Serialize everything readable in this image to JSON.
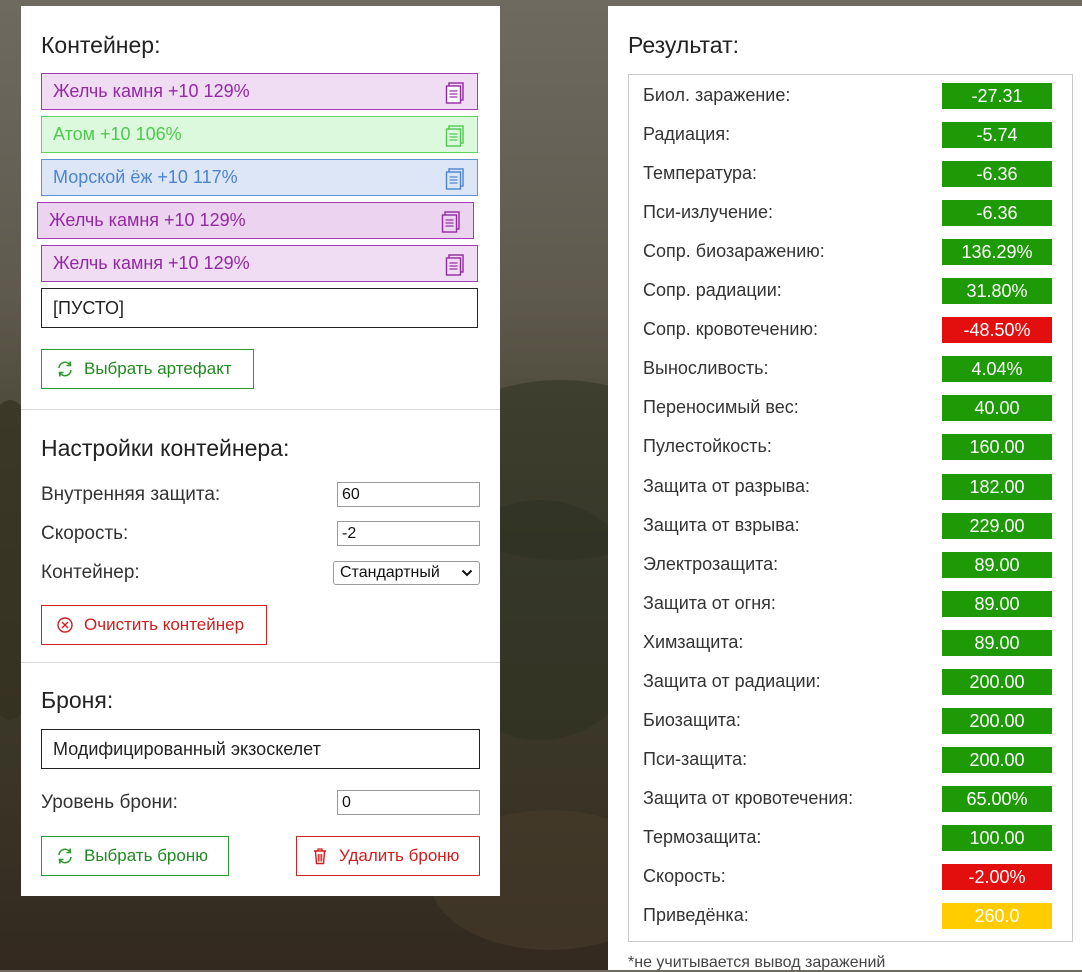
{
  "container": {
    "title": "Контейнер:",
    "slots": [
      {
        "label": "Желчь камня +10 129%",
        "style": "purple"
      },
      {
        "label": "Атом +10 106%",
        "style": "green"
      },
      {
        "label": "Морской ёж +10 117%",
        "style": "blue"
      },
      {
        "label": "Желчь камня +10 129%",
        "style": "purple2"
      },
      {
        "label": "Желчь камня +10 129%",
        "style": "purple"
      },
      {
        "label": "[ПУСТО]",
        "style": "empty"
      }
    ],
    "select_artifact_label": "Выбрать артефакт"
  },
  "settings": {
    "title": "Настройки контейнера:",
    "internal_protection_label": "Внутренняя защита:",
    "internal_protection_value": "60",
    "speed_label": "Скорость:",
    "speed_value": "-2",
    "container_label": "Контейнер:",
    "container_type": "Стандартный",
    "clear_label": "Очистить контейнер"
  },
  "armor": {
    "title": "Броня:",
    "name": "Модифицированный экзоскелет",
    "level_label": "Уровень брони:",
    "level_value": "0",
    "select_label": "Выбрать броню",
    "delete_label": "Удалить броню"
  },
  "results": {
    "title": "Результат:",
    "rows": [
      {
        "name": "Биол. заражение:",
        "value": "-27.31",
        "color": "#1d9a06"
      },
      {
        "name": "Радиация:",
        "value": "-5.74",
        "color": "#1d9a06"
      },
      {
        "name": "Температура:",
        "value": "-6.36",
        "color": "#1d9a06"
      },
      {
        "name": "Пси-излучение:",
        "value": "-6.36",
        "color": "#1d9a06"
      },
      {
        "name": "Сопр. биозаражению:",
        "value": "136.29%",
        "color": "#1d9a06"
      },
      {
        "name": "Сопр. радиации:",
        "value": "31.80%",
        "color": "#1d9a06"
      },
      {
        "name": "Сопр. кровотечению:",
        "value": "-48.50%",
        "color": "#e30e0e"
      },
      {
        "name": "Выносливость:",
        "value": "4.04%",
        "color": "#1d9a06"
      },
      {
        "name": "Переносимый вес:",
        "value": "40.00",
        "color": "#1d9a06"
      },
      {
        "name": "Пулестойкость:",
        "value": "160.00",
        "color": "#1d9a06"
      },
      {
        "name": "Защита от разрыва:",
        "value": "182.00",
        "color": "#1d9a06"
      },
      {
        "name": "Защита от взрыва:",
        "value": "229.00",
        "color": "#1d9a06"
      },
      {
        "name": "Электрозащита:",
        "value": "89.00",
        "color": "#1d9a06"
      },
      {
        "name": "Защита от огня:",
        "value": "89.00",
        "color": "#1d9a06"
      },
      {
        "name": "Химзащита:",
        "value": "89.00",
        "color": "#1d9a06"
      },
      {
        "name": "Защита от радиации:",
        "value": "200.00",
        "color": "#1d9a06"
      },
      {
        "name": "Биозащита:",
        "value": "200.00",
        "color": "#1d9a06"
      },
      {
        "name": "Пси-защита:",
        "value": "200.00",
        "color": "#1d9a06"
      },
      {
        "name": "Защита от кровотечения:",
        "value": "65.00%",
        "color": "#1d9a06"
      },
      {
        "name": "Термозащита:",
        "value": "100.00",
        "color": "#1d9a06"
      },
      {
        "name": "Скорость:",
        "value": "-2.00%",
        "color": "#e30e0e"
      },
      {
        "name": "Приведёнка:",
        "value": "260.0",
        "color": "#ffcc00"
      }
    ],
    "footnote": "*не учитывается вывод заражений"
  }
}
